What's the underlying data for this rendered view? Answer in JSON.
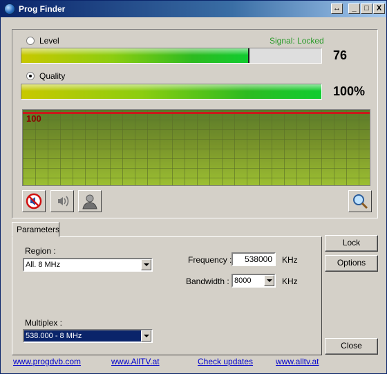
{
  "window": {
    "title": "Prog Finder",
    "restore_glyph": "↔",
    "minimize_glyph": "_",
    "maximize_glyph": "□",
    "close_glyph": "X"
  },
  "signal": {
    "level_label": "Level",
    "quality_label": "Quality",
    "status": "Signal: Locked",
    "level_value": "76",
    "quality_value": "100%",
    "level_percent": 76,
    "quality_percent": 100,
    "selected_mode": "Quality"
  },
  "graph": {
    "label": "100",
    "value": 100,
    "line_color": "#c81a1a"
  },
  "toolbar": {
    "icons": [
      "mute-icon",
      "sound-icon",
      "user-icon",
      "search-icon"
    ]
  },
  "tabs": [
    {
      "label": "Parameters",
      "active": true
    }
  ],
  "parameters": {
    "region_label": "Region :",
    "region_value": "All. 8 MHz",
    "frequency_label": "Frequency :",
    "frequency_value": "538000",
    "frequency_unit": "KHz",
    "bandwidth_label": "Bandwidth :",
    "bandwidth_value": "8000",
    "bandwidth_unit": "KHz",
    "multiplex_label": "Multiplex :",
    "multiplex_value": "538.000 - 8 MHz"
  },
  "buttons": {
    "lock": "Lock",
    "options": "Options",
    "close": "Close"
  },
  "links": {
    "progdvb": "www.progdvb.com",
    "alltv_upper": "www.AllTV.at",
    "check_updates": "Check updates",
    "alltv_lower": "www.alltv.at"
  },
  "colors": {
    "signal_status": "#2a9a2a",
    "graph_label": "#8b0000",
    "link": "#0000cc",
    "selection": "#0a246a"
  }
}
